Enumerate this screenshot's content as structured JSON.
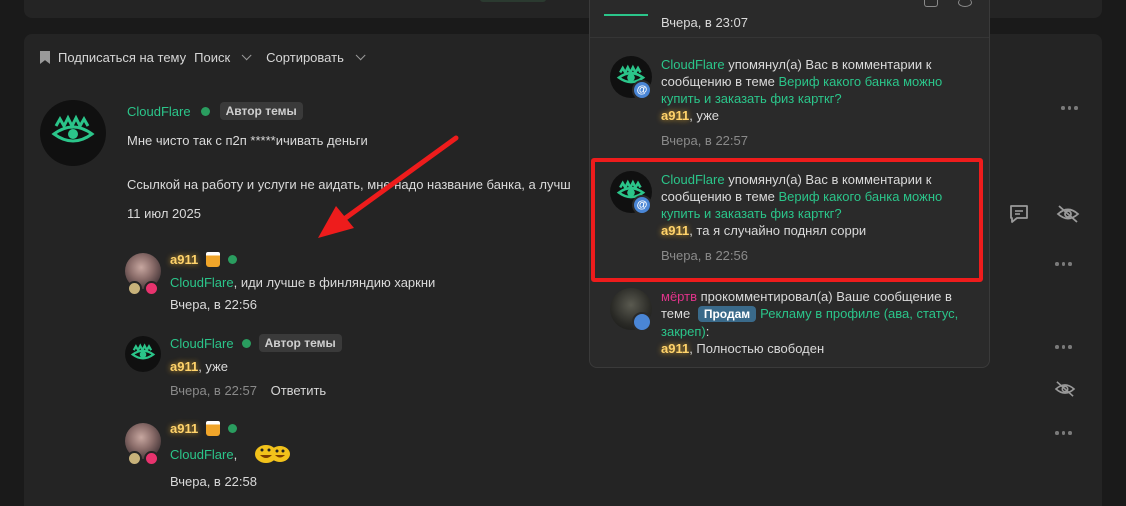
{
  "toolbar": {
    "subscribe_label": "Подписаться на тему",
    "search_label": "Поиск",
    "sort_label": "Сортировать"
  },
  "post": {
    "author": "CloudFlare",
    "author_badge": "Автор темы",
    "line1": "Мне чисто так с п2п *****ичивать деньги",
    "line2": "Ссылкой на работу и услуги не аидать, мне надо название банка, а лучш",
    "date": "11 июл 2025"
  },
  "comments": [
    {
      "author": "a911",
      "mention": "CloudFlare",
      "text": ", иди лучше в финляндию харкни",
      "time": "Вчера, в 22:56"
    },
    {
      "author": "CloudFlare",
      "badge": "Автор темы",
      "mention": "a911",
      "text": ", уже",
      "time": "Вчера, в 22:57",
      "reply_label": "Ответить"
    },
    {
      "author": "a911",
      "mention": "CloudFlare",
      "text": ",",
      "time": "Вчера, в 22:58"
    }
  ],
  "popup": {
    "top_time": "Вчера, в 23:07",
    "notifications": [
      {
        "user": "CloudFlare",
        "action": " упомянул(а) Вас в комментарии к сообщению в теме ",
        "link": "Вериф какого банка можно купить и заказать физ карткг?",
        "mention": "a911",
        "text": ", уже",
        "time": "Вчера, в 22:57"
      },
      {
        "user": "CloudFlare",
        "action": " упомянул(а) Вас в комментарии к сообщению в теме ",
        "link": "Вериф какого банка можно купить и заказать физ карткг?",
        "mention": "a911",
        "text": ", та я случайно поднял сорри",
        "time": "Вчера, в 22:56"
      },
      {
        "user": "мёртв",
        "action": " прокомментировал(а) Ваше сообщение в теме ",
        "prefix": "Продам",
        "link": "Рекламу в профиле (ава, статус, закреп)",
        "link_suffix": ":",
        "mention": "a911",
        "text": ", Полностью свободен"
      }
    ]
  },
  "colors": {
    "accent": "#2bc58a",
    "highlight_box": "#ee1c1c",
    "arrow": "#ee1c1c"
  }
}
